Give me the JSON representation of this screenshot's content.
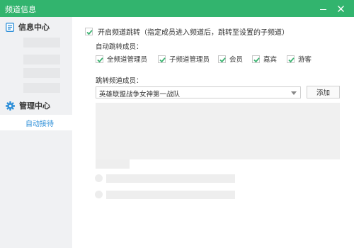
{
  "window": {
    "title": "频道信息",
    "accent_color": "#32b46e",
    "controls": [
      "minimize-icon",
      "close-icon"
    ]
  },
  "sidebar": {
    "sections": [
      {
        "label": "信息中心",
        "icon": "document-icon"
      },
      {
        "label": "管理中心",
        "icon": "gear-icon"
      }
    ],
    "active_item": "自动接待",
    "active_color": "#2e8fd8"
  },
  "main": {
    "enable_jump": {
      "label": "开启频道跳转（指定成员进入频道后，跳转至设置的子频道）",
      "checked": true
    },
    "auto_jump_label": "自动跳转成员：",
    "roles": [
      {
        "label": "全频道管理员",
        "checked": true
      },
      {
        "label": "子频道管理员",
        "checked": true
      },
      {
        "label": "会员",
        "checked": true
      },
      {
        "label": "嘉宾",
        "checked": true
      },
      {
        "label": "游客",
        "checked": true
      }
    ],
    "jump_channel_label": "跳转频道成员：",
    "channel_select": {
      "value": "英雄联盟战争女神第一战队"
    },
    "add_button": "添加"
  }
}
